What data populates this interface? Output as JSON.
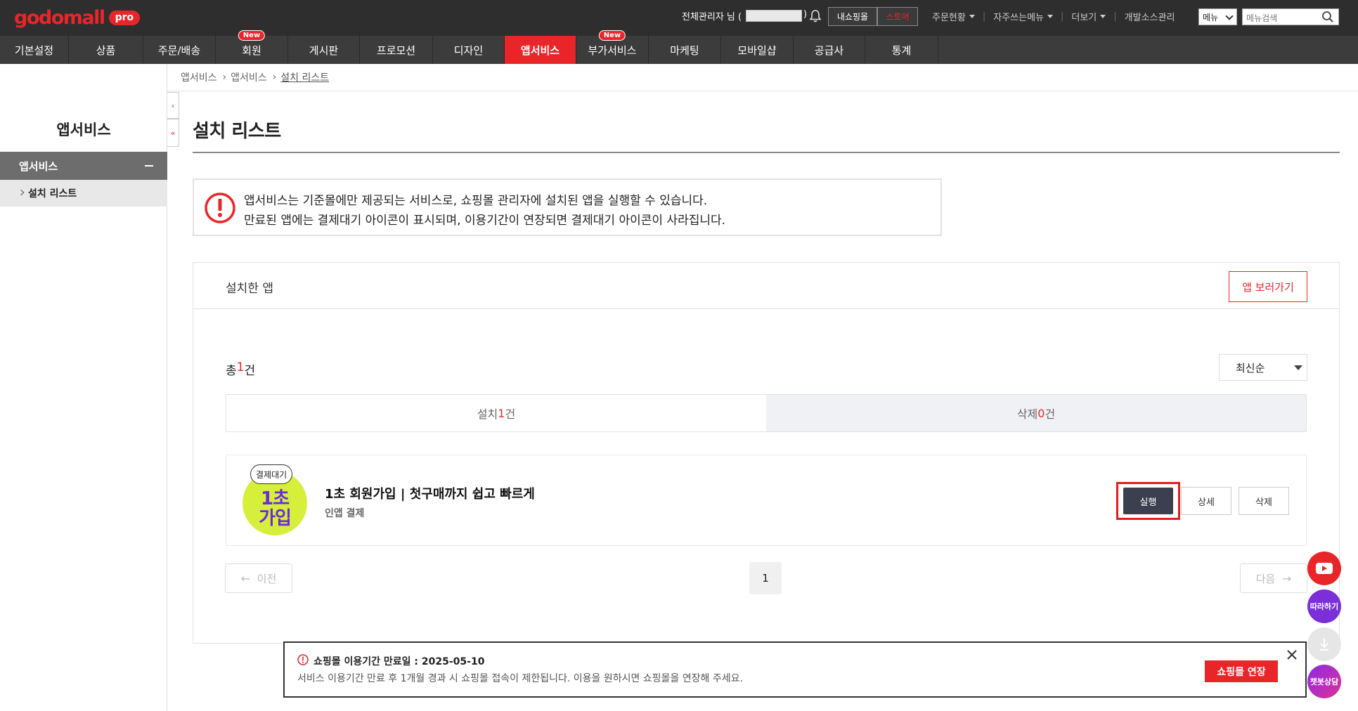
{
  "header": {
    "logo": "godomall",
    "logo_badge": "pro",
    "admin_label": "전체관리자 님 (",
    "admin_close": ")",
    "my_shop": "내쇼핑몰",
    "store": "스토어",
    "links": [
      "주문현황",
      "자주쓰는메뉴",
      "더보기",
      "개발소스관리"
    ],
    "menu_select": "메뉴",
    "menu_search_placeholder": "메뉴검색"
  },
  "nav": {
    "items": [
      {
        "label": "기본설정"
      },
      {
        "label": "상품"
      },
      {
        "label": "주문/배송"
      },
      {
        "label": "회원",
        "badge": "New"
      },
      {
        "label": "게시판"
      },
      {
        "label": "프로모션"
      },
      {
        "label": "디자인"
      },
      {
        "label": "앱서비스",
        "active": true
      },
      {
        "label": "부가서비스",
        "badge": "New"
      },
      {
        "label": "마케팅"
      },
      {
        "label": "모바일샵"
      },
      {
        "label": "공급사"
      },
      {
        "label": "통계"
      }
    ]
  },
  "sidebar": {
    "title": "앱서비스",
    "section": "앱서비스",
    "item": "설치 리스트"
  },
  "breadcrumb": [
    "앱서비스",
    "앱서비스",
    "설치 리스트"
  ],
  "page": {
    "title": "설치 리스트",
    "notice_line1": "앱서비스는 기준몰에만 제공되는 서비스로, 쇼핑몰 관리자에 설치된 앱을 실행할 수 있습니다.",
    "notice_line2": "만료된 앱에는 결제대기 아이콘이 표시되며, 이용기간이 연장되면 결제대기 아이콘이 사라집니다."
  },
  "panel": {
    "title": "설치한 앱",
    "app_view_button": "앱 보러가기",
    "total_prefix": "총 ",
    "total_count": "1",
    "total_suffix": "건",
    "sort": "최신순",
    "tabs": [
      {
        "label": "설치 ",
        "count": "1",
        "suffix": "건"
      },
      {
        "label": "삭제 ",
        "count": "0",
        "suffix": "건"
      }
    ]
  },
  "app": {
    "thumb_text_top": "1초",
    "thumb_text_bottom": "가입",
    "badge": "결제대기",
    "name": "1초 회원가입 | 첫구매까지 쉽고 빠르게",
    "type": "인앱 결제",
    "run": "실행",
    "detail": "상세",
    "delete": "삭제"
  },
  "pagination": {
    "prev": "이전",
    "page": "1",
    "next": "다음"
  },
  "expiry": {
    "title": "쇼핑몰 이용기간 만료일 : 2025-05-10",
    "desc": "서비스 이용기간 만료 후 1개월 경과 시 쇼핑몰 접속이 제한됩니다. 이용을 원하시면 쇼핑몰을 연장해 주세요.",
    "extend": "쇼핑몰 연장"
  },
  "fabs": {
    "follow": "따라하기",
    "chat": "챗봇상담"
  },
  "colors": {
    "brand": "#e8262a",
    "run_button": "#3b3f4f",
    "highlight": "#e01e1e"
  }
}
